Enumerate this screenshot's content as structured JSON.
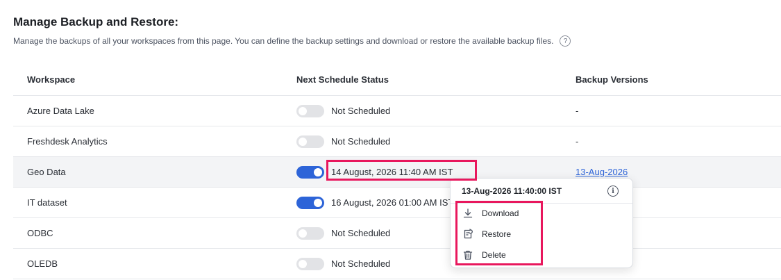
{
  "page": {
    "title": "Manage Backup and Restore:",
    "subtitle": "Manage the backups of all your workspaces from this page. You can define the backup settings and download or restore the available backup files.",
    "help_glyph": "?"
  },
  "table": {
    "headers": {
      "workspace": "Workspace",
      "status": "Next Schedule Status",
      "versions": "Backup Versions"
    },
    "rows": [
      {
        "workspace": "Azure Data Lake",
        "enabled": false,
        "status": "Not Scheduled",
        "version": "-"
      },
      {
        "workspace": "Freshdesk Analytics",
        "enabled": false,
        "status": "Not Scheduled",
        "version": "-"
      },
      {
        "workspace": "Geo Data",
        "enabled": true,
        "status": "14 August, 2026 11:40 AM IST",
        "version": "13-Aug-2026"
      },
      {
        "workspace": "IT dataset",
        "enabled": true,
        "status": "16 August, 2026 01:00 AM IST",
        "version": ""
      },
      {
        "workspace": "ODBC",
        "enabled": false,
        "status": "Not Scheduled",
        "version": ""
      },
      {
        "workspace": "OLEDB",
        "enabled": false,
        "status": "Not Scheduled",
        "version": ""
      }
    ]
  },
  "popover": {
    "timestamp": "13-Aug-2026 11:40:00 IST",
    "info_glyph": "i",
    "items": [
      {
        "label": "Download",
        "icon": "download-icon"
      },
      {
        "label": "Restore",
        "icon": "restore-icon"
      },
      {
        "label": "Delete",
        "icon": "trash-icon"
      }
    ]
  },
  "colors": {
    "accent": "#2d64d8",
    "highlight_box": "#e8175d",
    "row_highlight": "#f3f4f6"
  }
}
